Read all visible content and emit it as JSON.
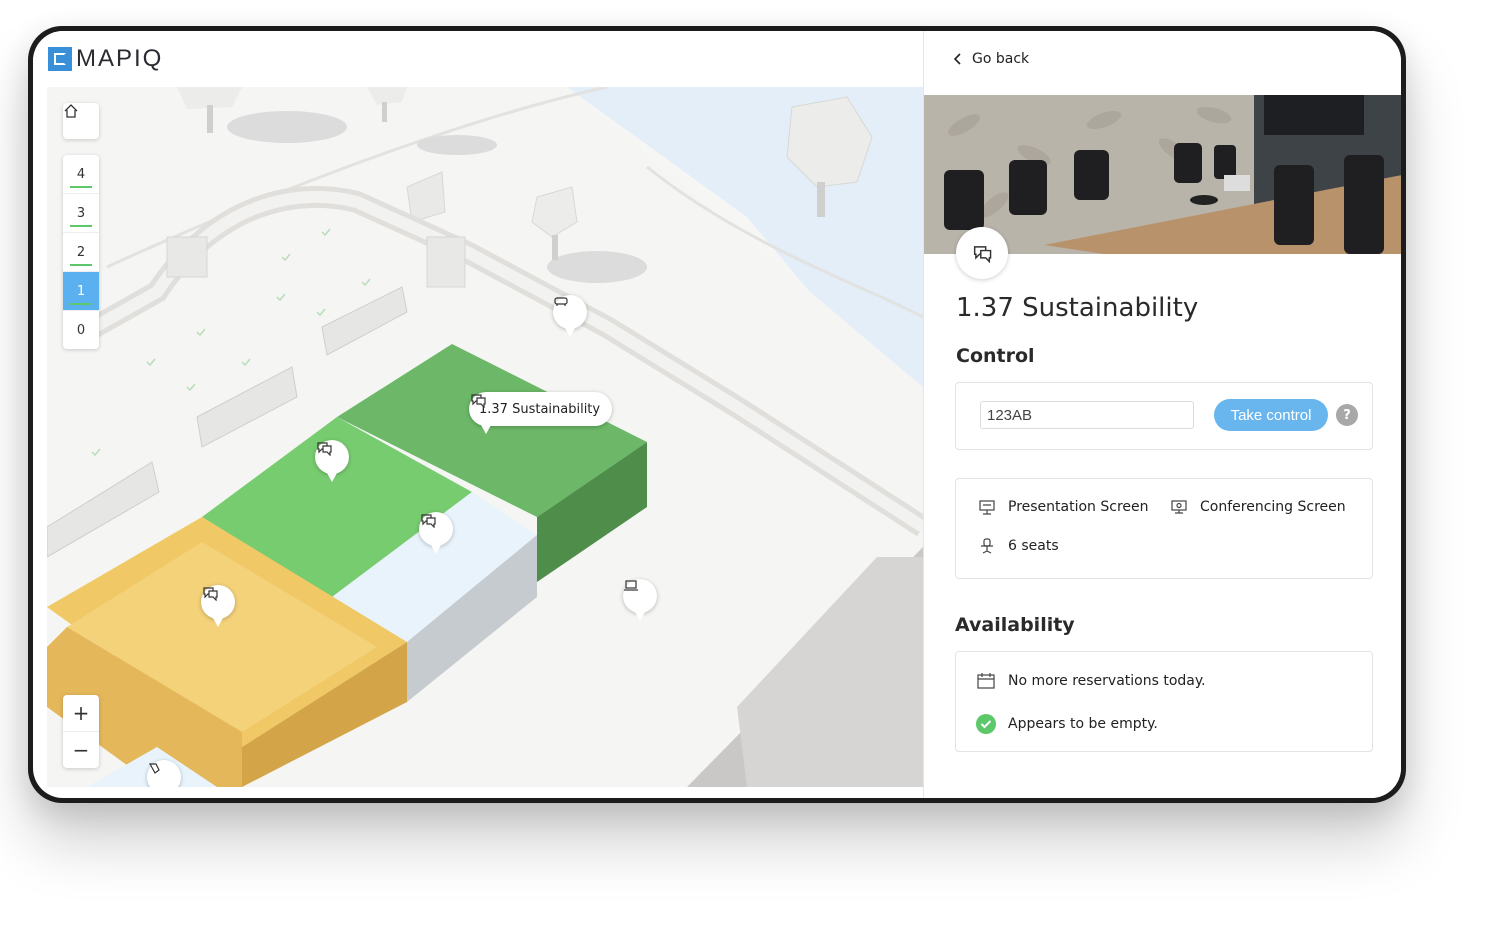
{
  "app": {
    "brand": "MAPIQ"
  },
  "map": {
    "floors": [
      "4",
      "3",
      "2",
      "1",
      "0"
    ],
    "active_floor": "1",
    "zoom_in": "+",
    "zoom_out": "−",
    "selected_label": "1.37 Sustainability"
  },
  "panel": {
    "go_back": "Go back",
    "room_title": "1.37 Sustainability",
    "control_heading": "Control",
    "control_code_value": "123AB",
    "take_control": "Take control",
    "help": "?",
    "features": {
      "presentation": "Presentation Screen",
      "conferencing": "Conferencing Screen",
      "seats": "6 seats"
    },
    "availability_heading": "Availability",
    "availability": {
      "reservations": "No more reservations today.",
      "occupancy": "Appears to be empty."
    }
  },
  "colors": {
    "accent_blue": "#5bb1ef",
    "room_green": "#6fc46a",
    "room_yellow": "#f1c86d",
    "status_green": "#5cc86a"
  }
}
